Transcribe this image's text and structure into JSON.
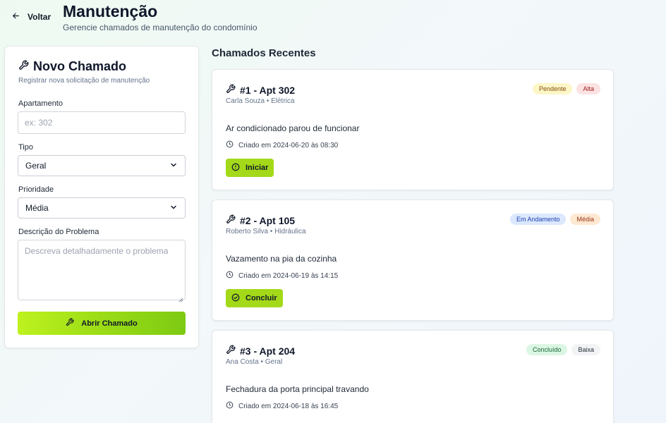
{
  "header": {
    "back_label": "Voltar",
    "title": "Manutenção",
    "subtitle": "Gerencie chamados de manutenção do condomínio"
  },
  "form": {
    "title": "Novo Chamado",
    "subtitle": "Registrar nova solicitação de manutenção",
    "apartment": {
      "label": "Apartamento",
      "placeholder": "ex: 302",
      "value": ""
    },
    "type": {
      "label": "Tipo",
      "value": "Geral"
    },
    "priority": {
      "label": "Prioridade",
      "value": "Média"
    },
    "description": {
      "label": "Descrição do Problema",
      "placeholder": "Descreva detalhadamente o problema",
      "value": ""
    },
    "submit_label": "Abrir Chamado"
  },
  "tickets_section": {
    "title": "Chamados Recentes",
    "tickets": [
      {
        "title": "#1 - Apt 302",
        "meta": "Carla Souza • Elétrica",
        "status": "Pendente",
        "priority": "Alta",
        "description": "Ar condicionado parou de funcionar",
        "created": "Criado em 2024-06-20 às 08:30",
        "action": "Iniciar"
      },
      {
        "title": "#2 - Apt 105",
        "meta": "Roberto Silva • Hidráulica",
        "status": "Em Andamento",
        "priority": "Média",
        "description": "Vazamento na pia da cozinha",
        "created": "Criado em 2024-06-19 às 14:15",
        "action": "Concluir"
      },
      {
        "title": "#3 - Apt 204",
        "meta": "Ana Costa • Geral",
        "status": "Concluído",
        "priority": "Baixa",
        "description": "Fechadura da porta principal travando",
        "created": "Criado em 2024-06-18 às 16:45"
      }
    ]
  },
  "colors": {
    "accent_green": "#a3d919",
    "badge_pendente_bg": "#fdf6c7",
    "badge_alta_bg": "#fde2e2",
    "badge_andamento_bg": "#dbe8fd",
    "badge_media_bg": "#fde8d2",
    "badge_concluido_bg": "#dcf6e4",
    "badge_baixa_bg": "#f1f3f5"
  }
}
